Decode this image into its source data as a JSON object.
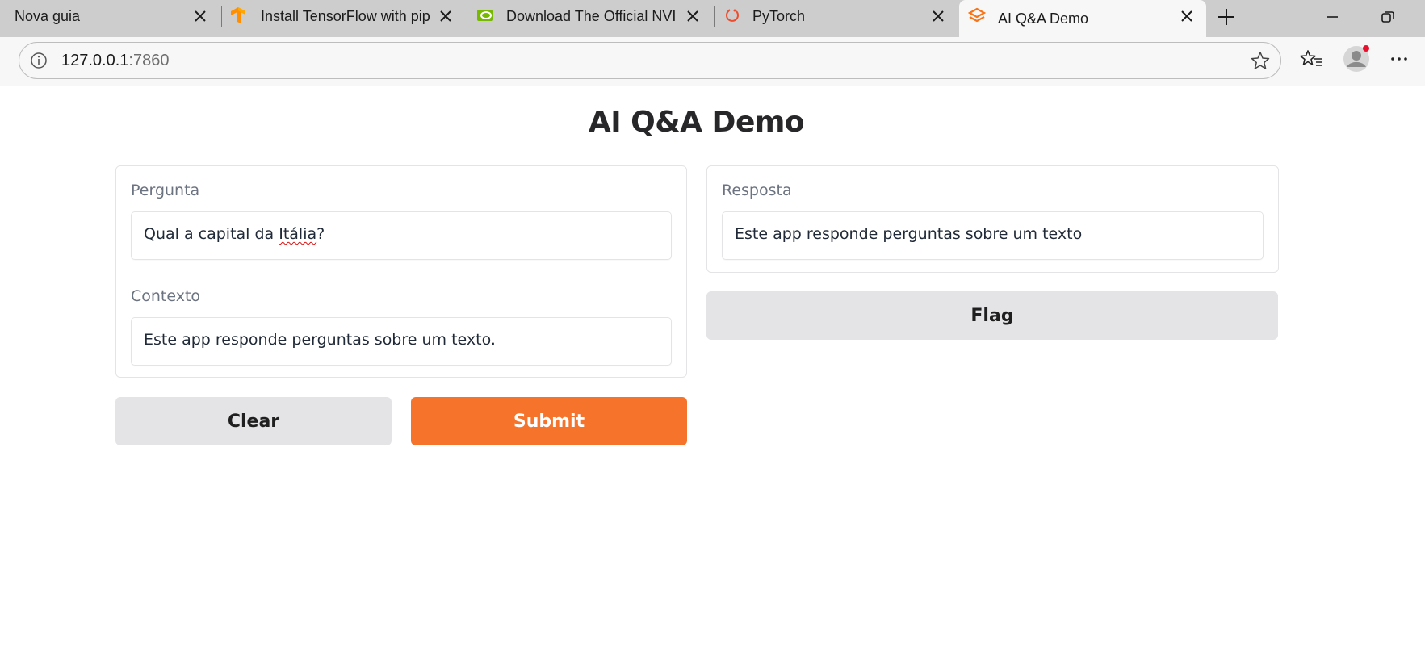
{
  "browser": {
    "tabs": [
      {
        "title": "Nova guia",
        "icon": "new-tab-icon"
      },
      {
        "title": "Install TensorFlow with pip",
        "icon": "tensorflow-icon"
      },
      {
        "title": "Download The Official NVIDIA",
        "icon": "nvidia-icon"
      },
      {
        "title": "PyTorch",
        "icon": "pytorch-icon"
      },
      {
        "title": "AI Q&A Demo",
        "icon": "gradio-icon",
        "active": true
      }
    ],
    "address": {
      "host": "127.0.0.1",
      "port": ":7860"
    }
  },
  "app": {
    "title": "AI Q&A Demo",
    "inputs": {
      "question": {
        "label": "Pergunta",
        "value_before": "Qual a capital da ",
        "value_misspelled": "Itália",
        "value_after": "?"
      },
      "context": {
        "label": "Contexto",
        "value": "Este app responde perguntas sobre um texto."
      }
    },
    "output": {
      "label": "Resposta",
      "value": "Este app responde perguntas sobre um texto"
    },
    "buttons": {
      "clear": "Clear",
      "submit": "Submit",
      "flag": "Flag"
    }
  },
  "colors": {
    "primary": "#f5732b",
    "secondary": "#e4e4e7",
    "chrome": "#cdcdcd"
  }
}
